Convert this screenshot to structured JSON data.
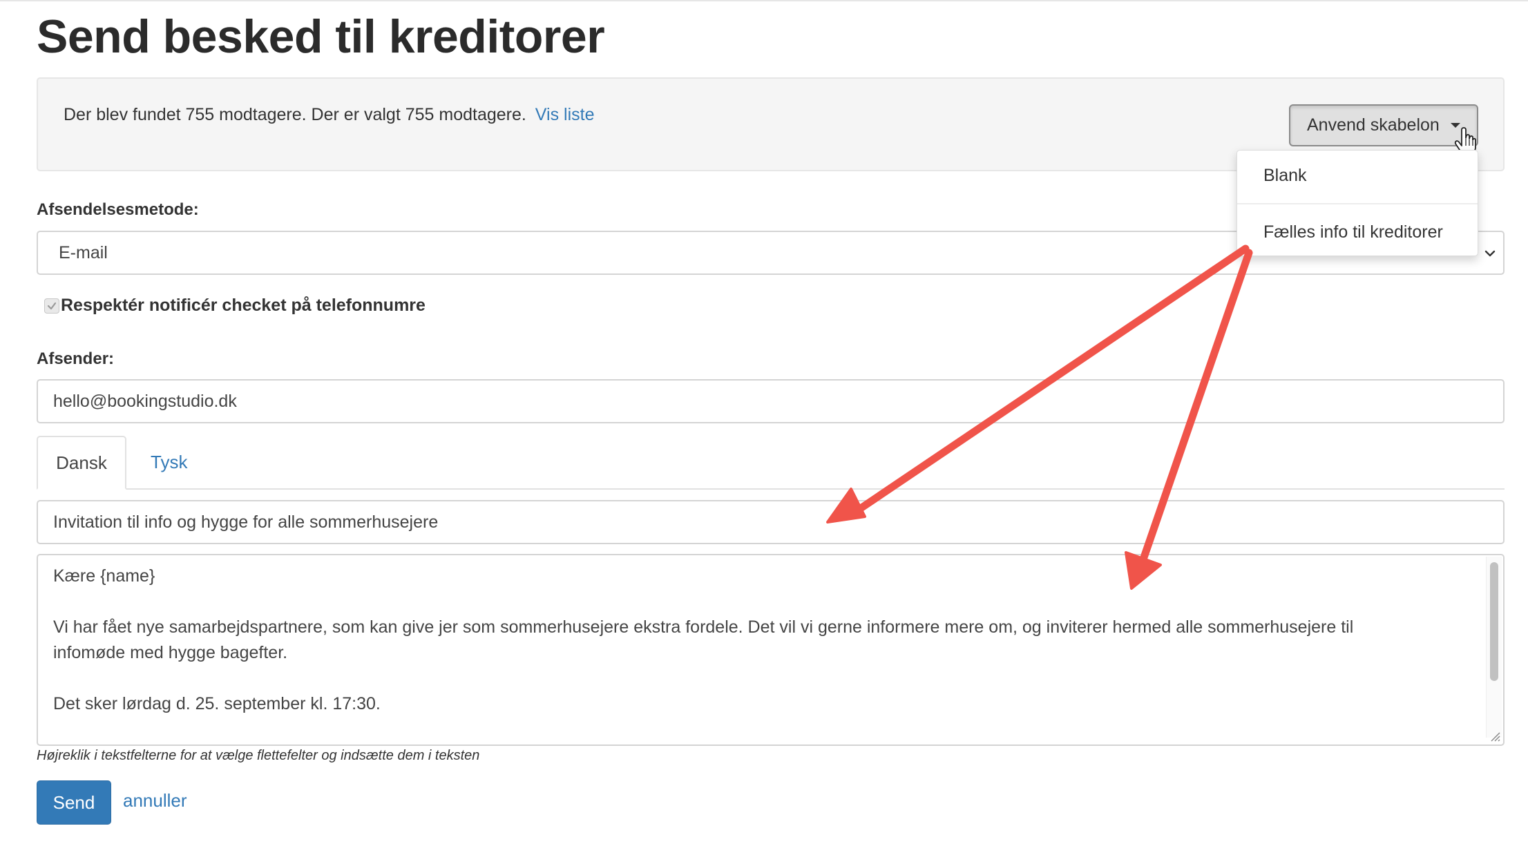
{
  "page": {
    "title": "Send besked til kreditorer"
  },
  "info": {
    "text": "Der blev fundet 755 modtagere. Der er valgt 755 modtagere.",
    "link_label": "Vis liste"
  },
  "template": {
    "button_label": "Anvend skabelon",
    "options": [
      "Blank",
      "Fælles info til kreditorer"
    ]
  },
  "send_method": {
    "label": "Afsendelsesmetode:",
    "value": "E-mail"
  },
  "respect_notify": {
    "label": "Respektér notificér checket på telefonnumre",
    "checked": true
  },
  "sender": {
    "label": "Afsender:",
    "value": "hello@bookingstudio.dk"
  },
  "tabs": {
    "items": [
      "Dansk",
      "Tysk"
    ],
    "active": "Dansk"
  },
  "message": {
    "subject": "Invitation til info og hygge for alle sommerhusejere",
    "body_lines": [
      "Kære {name}",
      "Vi har fået nye samarbejdspartnere, som kan give jer som sommerhusejere ekstra fordele. Det vil vi gerne informere mere om, og inviterer hermed alle sommerhusejere til",
      "infomøde med hygge bagefter.",
      "Det sker lørdag d. 25. september kl. 17:30."
    ],
    "hint": "Højreklik i tekstfelterne for at vælge flettefelter og indsætte dem i teksten"
  },
  "actions": {
    "send_label": "Send",
    "cancel_label": "annuller"
  },
  "colors": {
    "accent": "#337ab7",
    "annotation_arrow": "#f0544a"
  }
}
